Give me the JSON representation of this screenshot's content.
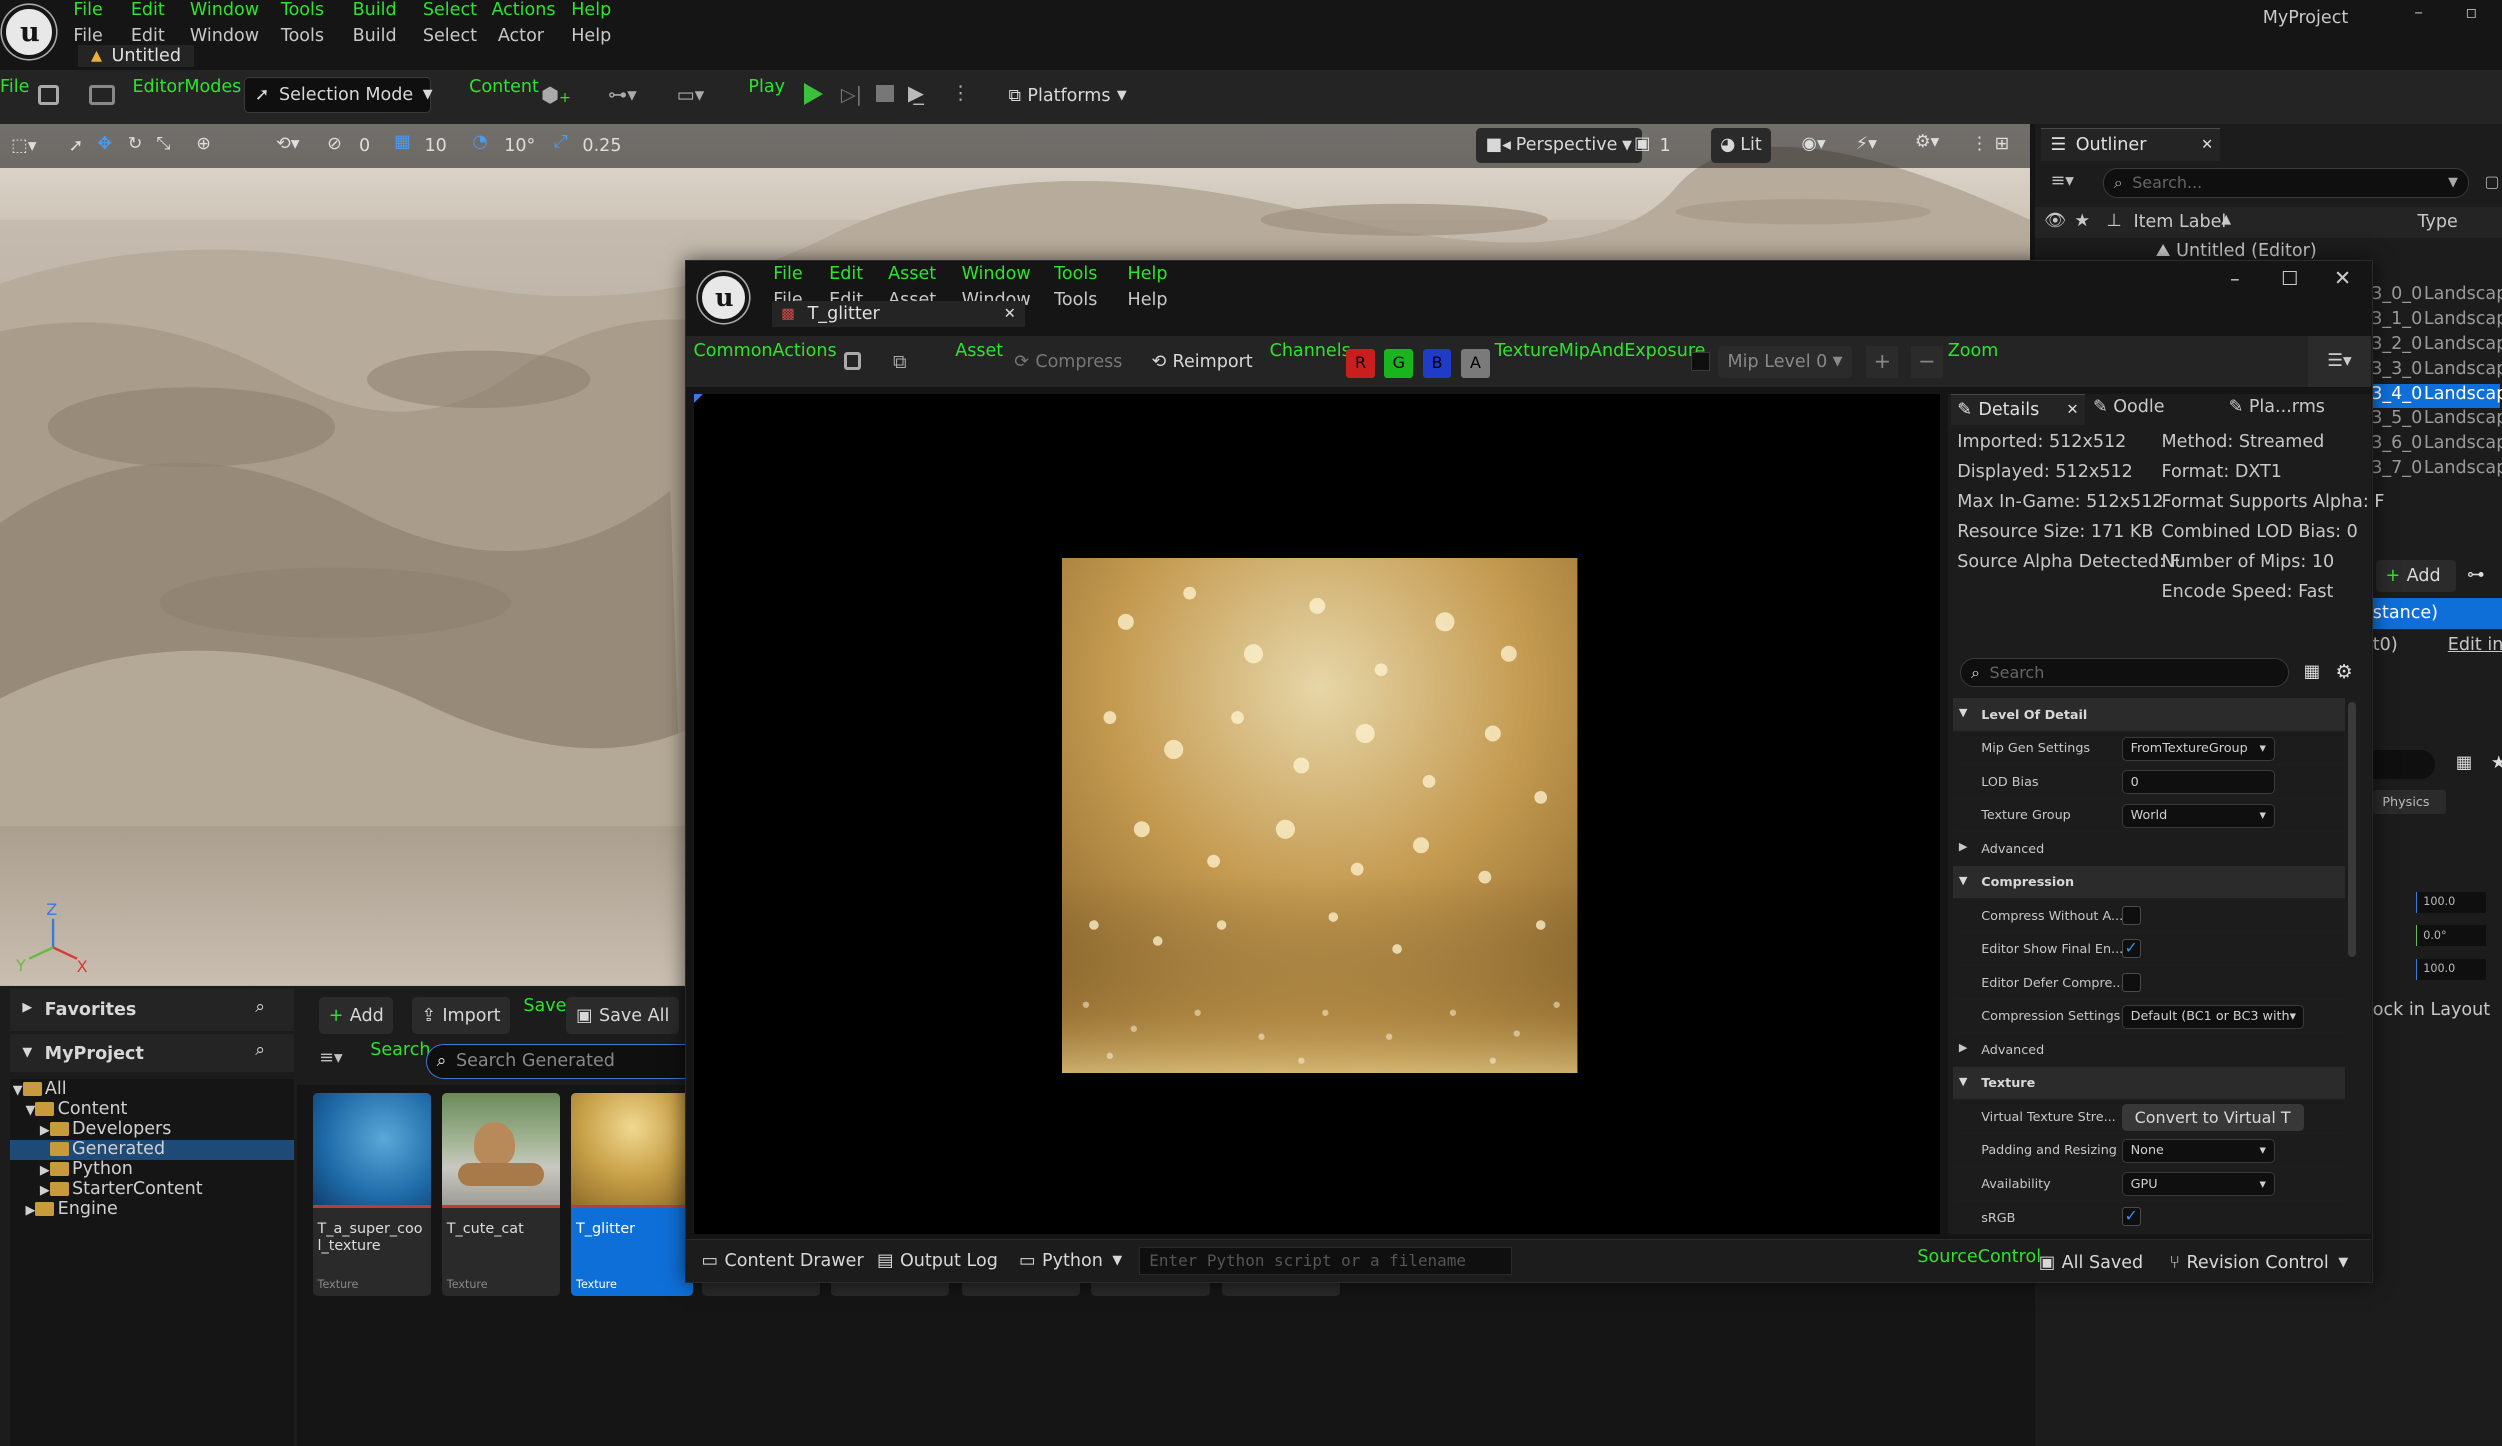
{
  "app": {
    "menu_top": [
      "File",
      "Edit",
      "Window",
      "Tools",
      "Build",
      "Select",
      "Actions",
      "Help"
    ],
    "menu_bottom": [
      "File",
      "Edit",
      "Window",
      "Tools",
      "Build",
      "Select",
      "Actor",
      "Help"
    ],
    "project_name": "MyProject",
    "level_tab": "Untitled"
  },
  "toolbar": {
    "file_label": "File",
    "editor_modes_label": "EditorModes",
    "selection_mode": "Selection Mode",
    "content_label": "Content",
    "play_label": "Play",
    "platforms": "Platforms"
  },
  "viewport": {
    "rotation_snap": "0",
    "grid_snap": "10",
    "angle_snap": "10°",
    "scale_snap": "0.25",
    "perspective": "Perspective",
    "camera_speed": "1",
    "view_mode": "Lit",
    "axis_labels": [
      "Z",
      "Y",
      "X"
    ]
  },
  "outliner": {
    "title": "Outliner",
    "search_placeholder": "Search...",
    "col_label": "Item Label",
    "col_type": "Type",
    "root": "Untitled (Editor)",
    "rows": [
      {
        "name": "3_0_0",
        "type": "Landscape"
      },
      {
        "name": "3_1_0",
        "type": "Landscape"
      },
      {
        "name": "3_2_0",
        "type": "Landscape"
      },
      {
        "name": "3_3_0",
        "type": "Landscape"
      },
      {
        "name": "3_4_0",
        "type": "Landscape"
      },
      {
        "name": "3_5_0",
        "type": "Landscape"
      },
      {
        "name": "3_6_0",
        "type": "Landscape"
      },
      {
        "name": "3_7_0",
        "type": "Landscape"
      }
    ],
    "add_label": "Add",
    "instance_label": "stance)",
    "instance_sub": "t0)",
    "edit_in": "Edit in C",
    "physics": "Physics",
    "val1": "100.0",
    "val2": "0.0°",
    "val3": "100.0",
    "lock_in_layout": "ock in Layout"
  },
  "content_browser": {
    "favorites": "Favorites",
    "project": "MyProject",
    "add": "Add",
    "import": "Import",
    "save_label": "Save",
    "save_all": "Save All",
    "search_label": "Search",
    "search_placeholder": "Search Generated",
    "tree": [
      "All",
      "Content",
      "Developers",
      "Generated",
      "Python",
      "StarterContent",
      "Engine"
    ],
    "assets": [
      {
        "name": "T_a_super_cool_texture",
        "type": "Texture"
      },
      {
        "name": "T_cute_cat",
        "type": "Texture"
      },
      {
        "name": "T_glitter",
        "type": "Texture"
      }
    ]
  },
  "texture_editor": {
    "menu_top": [
      "File",
      "Edit",
      "Asset",
      "Window",
      "Tools",
      "Help"
    ],
    "menu_bottom": [
      "File",
      "Edit",
      "Asset",
      "Window",
      "Tools",
      "Help"
    ],
    "tab": "T_glitter",
    "common_actions": "CommonActions",
    "asset_label": "Asset",
    "compress": "Compress",
    "reimport": "Reimport",
    "channels_label": "Channels",
    "channels": [
      "R",
      "G",
      "B",
      "A"
    ],
    "mip_label": "TextureMipAndExposure",
    "mip_level": "Mip Level 0",
    "zoom_label": "Zoom",
    "details_tab": "Details",
    "oodle_tab": "Oodle",
    "params_tab": "Pla...rms",
    "info_left": [
      "Imported: 512x512",
      "Displayed: 512x512",
      "Max In-Game: 512x512",
      "Resource Size: 171 KB",
      "Source Alpha Detected: F"
    ],
    "info_right": [
      "Method: Streamed",
      "Format: DXT1",
      "Format Supports Alpha: F",
      "Combined LOD Bias: 0",
      "Number of Mips: 10",
      "Encode Speed: Fast"
    ],
    "details_search": "Search",
    "sections": {
      "lod": "Level Of Detail",
      "mip_gen": "Mip Gen Settings",
      "mip_gen_val": "FromTextureGroup",
      "lod_bias": "LOD Bias",
      "lod_bias_val": "0",
      "tex_group": "Texture Group",
      "tex_group_val": "World",
      "advanced": "Advanced",
      "compression": "Compression",
      "compress_without": "Compress Without A...",
      "editor_show": "Editor Show Final En...",
      "editor_defer": "Editor Defer Compre...",
      "comp_settings": "Compression Settings",
      "comp_settings_val": "Default (BC1 or BC3 with",
      "texture": "Texture",
      "vt_stream": "Virtual Texture Stre...",
      "convert_vt": "Convert to Virtual T",
      "padding": "Padding and Resizing",
      "padding_val": "None",
      "availability": "Availability",
      "availability_val": "GPU",
      "srgb": "sRGB"
    }
  },
  "status_bar": {
    "content_drawer": "Content Drawer",
    "output_log": "Output Log",
    "python": "Python",
    "cmd_placeholder": "Enter Python script or a filename",
    "source_control": "SourceControl",
    "all_saved": "All Saved",
    "revision_control": "Revision Control"
  },
  "colors": {
    "accent_green": "#2ee32e",
    "selection_blue": "#0f6fd8",
    "channel_r": "#c81e1e",
    "channel_g": "#19b51e",
    "channel_b": "#1e3cc8",
    "channel_a": "#7a7a7a"
  }
}
